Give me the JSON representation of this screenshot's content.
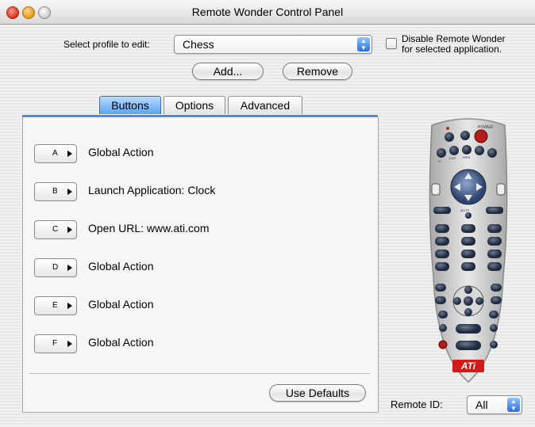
{
  "window": {
    "title": "Remote Wonder Control Panel"
  },
  "profile": {
    "label": "Select profile to edit:",
    "selected": "Chess",
    "disable_text_line1": "Disable Remote Wonder",
    "disable_text_line2": "for selected application.",
    "disable_checked": false
  },
  "actions": {
    "add": "Add...",
    "remove": "Remove"
  },
  "tabs": [
    {
      "label": "Buttons",
      "active": true
    },
    {
      "label": "Options",
      "active": false
    },
    {
      "label": "Advanced",
      "active": false
    }
  ],
  "rows": [
    {
      "key": "A",
      "action": "Global Action"
    },
    {
      "key": "B",
      "action": "Launch Application: Clock"
    },
    {
      "key": "C",
      "action": "Open URL: www.ati.com"
    },
    {
      "key": "D",
      "action": "Global Action"
    },
    {
      "key": "E",
      "action": "Global Action"
    },
    {
      "key": "F",
      "action": "Global Action"
    }
  ],
  "footer": {
    "use_defaults": "Use Defaults"
  },
  "remote": {
    "id_label": "Remote ID:",
    "id_value": "All",
    "brand": "ATi",
    "labels": {
      "power": "POWER",
      "tv": "TV",
      "dvd": "DVD",
      "web": "WEB",
      "mute": "MUTE"
    }
  },
  "colors": {
    "accent": "#4b8ce0",
    "tab_active": "#5ea2ef",
    "remote_body": "#cfcfcf",
    "brand_red": "#d11b1b"
  }
}
